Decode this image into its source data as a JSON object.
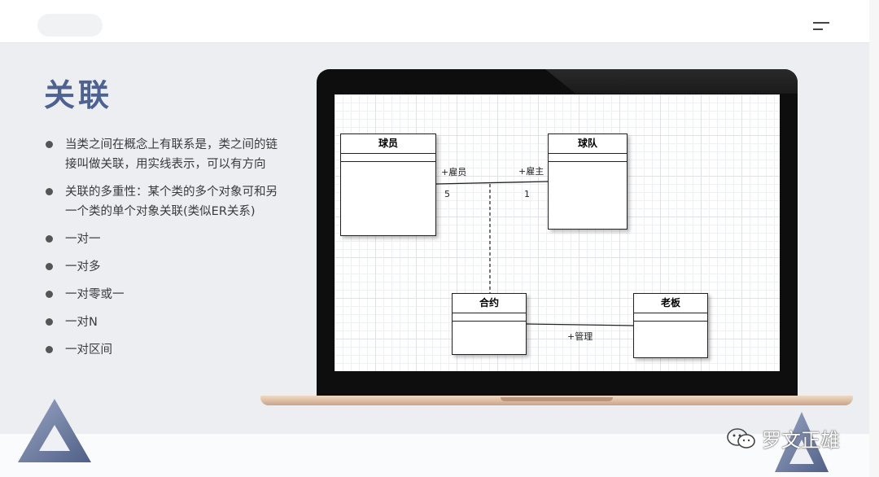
{
  "slide": {
    "title": "关联",
    "bullets": [
      "当类之间在概念上有联系是，类之间的链接叫做关联，用实线表示，可以有方向",
      "关联的多重性：某个类的多个对象可和另一个类的单个对象关联(类似ER关系)",
      "一对一",
      "一对多",
      "一对零或一",
      "一对N",
      "一对区间"
    ]
  },
  "diagram": {
    "classes": {
      "player": "球员",
      "team": "球队",
      "contract": "合约",
      "boss": "老板"
    },
    "labels": {
      "employee_role": "+雇员",
      "employer_role": "+雇主",
      "employee_mult": "5",
      "employer_mult": "1",
      "manage_role": "+管理"
    }
  },
  "watermark": "罗文正雄",
  "colors": {
    "title": "#4e6291",
    "slide_bg": "#eceef2",
    "triangle": "#6b7aa0"
  }
}
